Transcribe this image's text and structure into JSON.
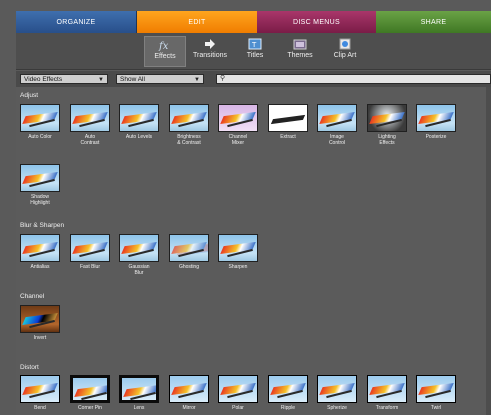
{
  "tabs": [
    {
      "label": "ORGANIZE"
    },
    {
      "label": "EDIT"
    },
    {
      "label": "DISC MENUS"
    },
    {
      "label": "SHARE"
    }
  ],
  "subtoolbar": {
    "items": [
      {
        "label": "Effects",
        "icon": "fx-icon"
      },
      {
        "label": "Transitions",
        "icon": "arrow-icon"
      },
      {
        "label": "Titles",
        "icon": "titles-icon"
      },
      {
        "label": "Themes",
        "icon": "film-icon"
      },
      {
        "label": "Clip Art",
        "icon": "clipart-icon"
      }
    ]
  },
  "filters": {
    "category": "Video Effects",
    "show": "Show All",
    "search_value": ""
  },
  "categories": [
    {
      "name": "Adjust",
      "items": [
        {
          "label": "Auto Color"
        },
        {
          "label": "Auto\nContrast"
        },
        {
          "label": "Auto Levels"
        },
        {
          "label": "Brightness\n& Contrast"
        },
        {
          "label": "Channel\nMixer"
        },
        {
          "label": "Extract"
        },
        {
          "label": "Image\nControl"
        },
        {
          "label": "Lighting\nEffects"
        },
        {
          "label": "Posterize"
        },
        {
          "label": "Shadow\nHighlight"
        }
      ]
    },
    {
      "name": "Blur & Sharpen",
      "items": [
        {
          "label": "Antialias"
        },
        {
          "label": "Fast Blur"
        },
        {
          "label": "Gaussian\nBlur"
        },
        {
          "label": "Ghosting"
        },
        {
          "label": "Sharpen"
        }
      ]
    },
    {
      "name": "Channel",
      "items": [
        {
          "label": "Invert"
        }
      ]
    },
    {
      "name": "Distort",
      "items": [
        {
          "label": "Bend"
        },
        {
          "label": "Corner Pin"
        },
        {
          "label": "Lens"
        },
        {
          "label": "Mirror"
        },
        {
          "label": "Polar"
        },
        {
          "label": "Ripple"
        },
        {
          "label": "Spherize"
        },
        {
          "label": "Transform"
        },
        {
          "label": "Twirl"
        }
      ]
    }
  ]
}
